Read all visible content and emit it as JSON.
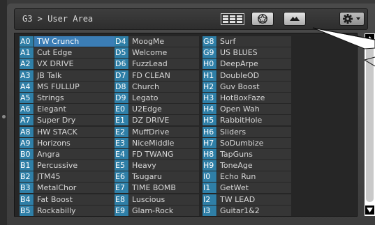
{
  "header": {
    "breadcrumb": "G3 > User Area",
    "icons": [
      "grid-view-icon",
      "effects-icon",
      "eject-icon",
      "gear-icon"
    ]
  },
  "columns": [
    [
      {
        "code": "A0",
        "name": "TW Crunch",
        "selected": true
      },
      {
        "code": "A1",
        "name": "Cut Edge"
      },
      {
        "code": "A2",
        "name": "VX DRIVE"
      },
      {
        "code": "A3",
        "name": "JB Talk"
      },
      {
        "code": "A4",
        "name": "MS FULLUP"
      },
      {
        "code": "A5",
        "name": "Strings"
      },
      {
        "code": "A6",
        "name": "Elegant"
      },
      {
        "code": "A7",
        "name": "Super Dry"
      },
      {
        "code": "A8",
        "name": "HW STACK"
      },
      {
        "code": "A9",
        "name": "Horizons"
      },
      {
        "code": "B0",
        "name": "Angra"
      },
      {
        "code": "B1",
        "name": "Percussive"
      },
      {
        "code": "B2",
        "name": "JTM45"
      },
      {
        "code": "B3",
        "name": "MetalChor"
      },
      {
        "code": "B4",
        "name": "Fat Boost"
      },
      {
        "code": "B5",
        "name": "Rockabilly"
      }
    ],
    [
      {
        "code": "D4",
        "name": "MoogMe"
      },
      {
        "code": "D5",
        "name": "Welcome"
      },
      {
        "code": "D6",
        "name": "FuzzLead"
      },
      {
        "code": "D7",
        "name": "FD CLEAN"
      },
      {
        "code": "D8",
        "name": "Church"
      },
      {
        "code": "D9",
        "name": "Legato"
      },
      {
        "code": "E0",
        "name": "U2Edge"
      },
      {
        "code": "E1",
        "name": "DZ DRIVE"
      },
      {
        "code": "E2",
        "name": "MuffDrive"
      },
      {
        "code": "E3",
        "name": "NiceMiddle"
      },
      {
        "code": "E4",
        "name": "FD TWANG"
      },
      {
        "code": "E5",
        "name": "Heavy"
      },
      {
        "code": "E6",
        "name": "Tsugaru"
      },
      {
        "code": "E7",
        "name": "TIME BOMB"
      },
      {
        "code": "E8",
        "name": "Luscious"
      },
      {
        "code": "E9",
        "name": "Glam-Rock"
      }
    ],
    [
      {
        "code": "G8",
        "name": "Surf"
      },
      {
        "code": "G9",
        "name": "US BLUES"
      },
      {
        "code": "H0",
        "name": "DeepArpe"
      },
      {
        "code": "H1",
        "name": "DoubleOD"
      },
      {
        "code": "H2",
        "name": "Guv Boost"
      },
      {
        "code": "H3",
        "name": "HotBoxFaze"
      },
      {
        "code": "H4",
        "name": "Open Wah"
      },
      {
        "code": "H5",
        "name": "RabbitHole"
      },
      {
        "code": "H6",
        "name": "Sliders"
      },
      {
        "code": "H7",
        "name": "SoDumbize"
      },
      {
        "code": "H8",
        "name": "TapGuns"
      },
      {
        "code": "H9",
        "name": "ToneAge"
      },
      {
        "code": "I0",
        "name": "Echo Run"
      },
      {
        "code": "I1",
        "name": "GetWet"
      },
      {
        "code": "I2",
        "name": "TW LEAD"
      },
      {
        "code": "I3",
        "name": "Guitar1&2"
      }
    ]
  ],
  "colors": {
    "code_bg": "#2f7fa7",
    "selected_bg": "#3b7db5",
    "cell_bg": "#363636",
    "list_bg": "#262626"
  }
}
